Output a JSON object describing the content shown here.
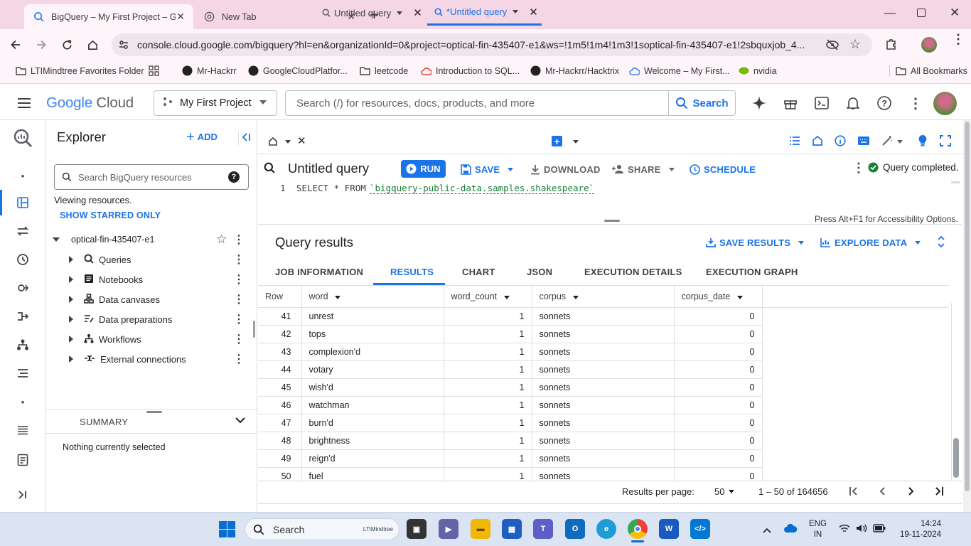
{
  "browser": {
    "tabs": [
      {
        "title": "BigQuery – My First Project – G",
        "active": true
      },
      {
        "title": "New Tab",
        "active": false
      }
    ],
    "new_tab_symbol": "+",
    "url": "console.cloud.google.com/bigquery?hl=en&organizationId=0&project=optical-fin-435407-e1&ws=!1m5!1m4!1m3!1soptical-fin-435407-e1!2sbquxjob_4...",
    "bookmarks": [
      {
        "label": "LTIMindtree Favorites Folder",
        "icon": "folder-icon"
      },
      {
        "label": "",
        "icon": "apps-grid-icon"
      },
      {
        "label": "Mr-Hackrr",
        "icon": "github-icon"
      },
      {
        "label": "GoogleCloudPlatfor...",
        "icon": "github-icon"
      },
      {
        "label": "leetcode",
        "icon": "folder-icon"
      },
      {
        "label": "Introduction to SQL...",
        "icon": "cloud-icon"
      },
      {
        "label": "Mr-Hackrr/Hacktrix",
        "icon": "github-icon"
      },
      {
        "label": "Welcome – My First...",
        "icon": "cloud-icon"
      },
      {
        "label": "nvidia",
        "icon": "nvidia-icon"
      }
    ],
    "all_bookmarks": "All Bookmarks"
  },
  "console": {
    "logo": {
      "google": "Google",
      "cloud": "Cloud"
    },
    "project": "My First Project",
    "search_placeholder": "Search (/) for resources, docs, products, and more",
    "search_button": "Search"
  },
  "explorer": {
    "title": "Explorer",
    "add": "ADD",
    "search_placeholder": "Search BigQuery resources",
    "viewing": "Viewing resources.",
    "show_starred": "SHOW STARRED ONLY",
    "project": "optical-fin-435407-e1",
    "items": [
      {
        "label": "Queries",
        "icon": "query-icon"
      },
      {
        "label": "Notebooks",
        "icon": "notebook-icon"
      },
      {
        "label": "Data canvases",
        "icon": "canvas-icon"
      },
      {
        "label": "Data preparations",
        "icon": "preparation-icon"
      },
      {
        "label": "Workflows",
        "icon": "workflow-icon"
      },
      {
        "label": "External connections",
        "icon": "connection-icon"
      }
    ],
    "summary_title": "SUMMARY",
    "summary_text": "Nothing currently selected"
  },
  "editor": {
    "tabs": [
      {
        "label": "Untitled query",
        "active": false
      },
      {
        "label": "*Untitled query",
        "active": true
      }
    ],
    "title": "Untitled query",
    "buttons": {
      "run": "RUN",
      "save": "SAVE",
      "download": "DOWNLOAD",
      "share": "SHARE",
      "schedule": "SCHEDULE"
    },
    "status": "Query completed.",
    "line_number": "1",
    "sql_keyword": "SELECT * FROM",
    "sql_table": "`bigquery-public-data.samples.shakespeare`",
    "accessibility": "Press Alt+F1 for Accessibility Options."
  },
  "results": {
    "title": "Query results",
    "save_results": "SAVE RESULTS",
    "explore_data": "EXPLORE DATA",
    "tabs": [
      "JOB INFORMATION",
      "RESULTS",
      "CHART",
      "JSON",
      "EXECUTION DETAILS",
      "EXECUTION GRAPH"
    ],
    "active_tab": "RESULTS",
    "columns": [
      "Row",
      "word",
      "word_count",
      "corpus",
      "corpus_date"
    ],
    "rows": [
      [
        "41",
        "unrest",
        "1",
        "sonnets",
        "0"
      ],
      [
        "42",
        "tops",
        "1",
        "sonnets",
        "0"
      ],
      [
        "43",
        "complexion'd",
        "1",
        "sonnets",
        "0"
      ],
      [
        "44",
        "votary",
        "1",
        "sonnets",
        "0"
      ],
      [
        "45",
        "wish'd",
        "1",
        "sonnets",
        "0"
      ],
      [
        "46",
        "watchman",
        "1",
        "sonnets",
        "0"
      ],
      [
        "47",
        "burn'd",
        "1",
        "sonnets",
        "0"
      ],
      [
        "48",
        "brightness",
        "1",
        "sonnets",
        "0"
      ],
      [
        "49",
        "reign'd",
        "1",
        "sonnets",
        "0"
      ],
      [
        "50",
        "fuel",
        "1",
        "sonnets",
        "0"
      ]
    ],
    "per_page_label": "Results per page:",
    "per_page": "50",
    "range": "1 – 50 of 164656"
  },
  "taskbar": {
    "search": "Search",
    "search_badge": "LTIMindtree",
    "lang1": "ENG",
    "lang2": "IN",
    "time": "14:24",
    "date": "19-11-2024"
  },
  "colors": {
    "accent": "#1a73e8",
    "success": "#188038",
    "tabstrip": "#f4d6e4",
    "taskbar": "#dbe4f2"
  }
}
